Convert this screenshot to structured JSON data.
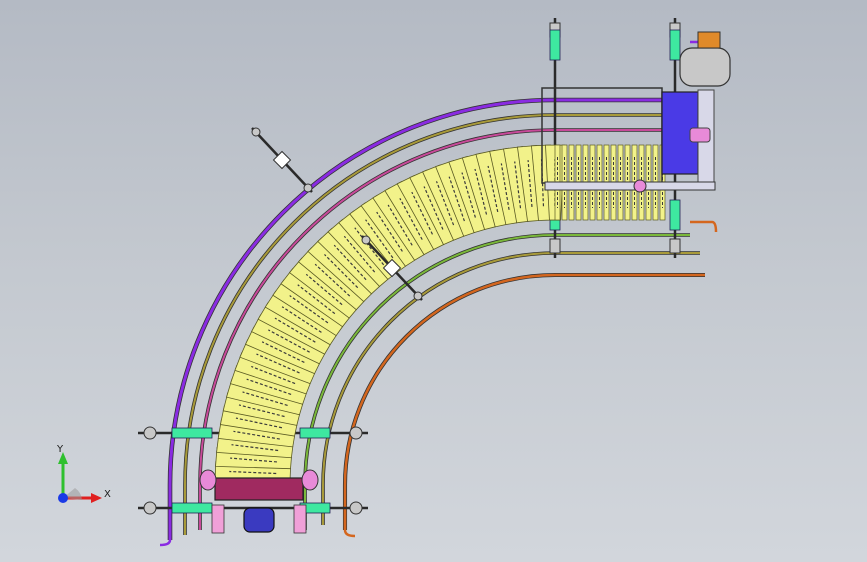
{
  "app": {
    "view": "cad-3d-viewport"
  },
  "triad": {
    "y_label": "Y",
    "x_label": "X"
  },
  "colors": {
    "background_top": "#b4bac4",
    "background_bottom": "#d2d6dc",
    "chain_slat": "#f2f28a",
    "chain_outline": "#5a5a22",
    "chain_inner_link": "#3a3a3a",
    "rail_outer_purple": "#8a2be2",
    "rail_olive": "#a89a3a",
    "rail_magenta": "#c84a9a",
    "rail_green": "#7ab83a",
    "rail_orange": "#d4661e",
    "rail_tan": "#c8a060",
    "bracket_bar": "#2a2a2a",
    "bracket_green": "#3ee8a0",
    "bracket_pink": "#f0a0d8",
    "bracket_clamp": "#c8c8c8",
    "drive_blue": "#4a3ae6",
    "drive_frame": "#d8d8e8",
    "end_block_maroon": "#a02a60",
    "motor_blue": "#3a3ac0",
    "motor_gray": "#c8c8c8",
    "motor_orange": "#e08a2a",
    "sprocket_pink": "#e88ad8",
    "triad_y": "#2ec02e",
    "triad_x": "#e02020",
    "triad_z": "#1a3ae6"
  }
}
